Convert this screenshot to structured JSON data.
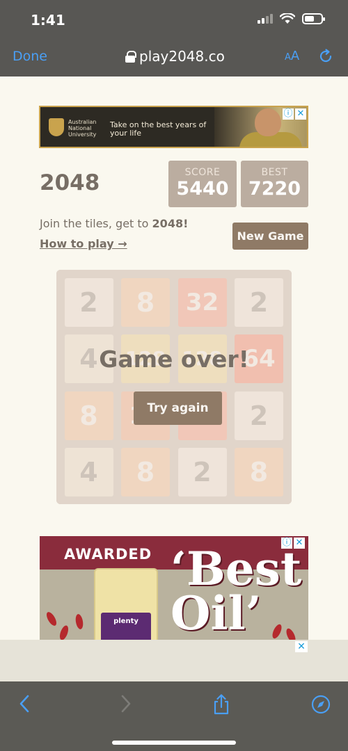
{
  "status_bar": {
    "time": "1:41"
  },
  "browser": {
    "done_label": "Done",
    "url": "play2048.co",
    "text_size_label_small": "A",
    "text_size_label_large": "A"
  },
  "ad_top": {
    "org_name": "Australian National University",
    "tagline": "Take on the best years of your life",
    "info_glyph": "ⓘ",
    "close_glyph": "✕"
  },
  "game": {
    "title": "2048",
    "score_label": "SCORE",
    "score_value": "5440",
    "best_label": "BEST",
    "best_value": "7220",
    "intro_text": "Join the tiles, get to ",
    "intro_bold": "2048!",
    "how_to_play": "How to play →",
    "new_game_label": "New Game",
    "game_over_text": "Game over!",
    "try_again_label": "Try again",
    "grid": [
      [
        "2",
        "8",
        "32",
        "2"
      ],
      [
        "4",
        "128",
        "128",
        "64"
      ],
      [
        "8",
        "16",
        "32",
        "2"
      ],
      [
        "4",
        "8",
        "2",
        "8"
      ]
    ]
  },
  "ad_bottom": {
    "awarded": "AWARDED",
    "headline_1": "‘Best",
    "headline_2": "Oil’",
    "brand": "plenty",
    "info_glyph": "ⓘ",
    "close_glyph": "✕"
  },
  "ad_strip": {
    "close_glyph": "✕"
  },
  "colors": {
    "accent": "#4a9ff5",
    "board": "#bbada0",
    "tile_2": "#eee4da",
    "tile_4": "#ede0c8",
    "tile_8": "#f2b179",
    "tile_16": "#f59563",
    "tile_32": "#f67c5f",
    "tile_64": "#f65e3b",
    "tile_128": "#edcf72"
  },
  "toolbar": {
    "icons": [
      "back-icon",
      "forward-icon",
      "share-icon",
      "compass-icon"
    ]
  }
}
